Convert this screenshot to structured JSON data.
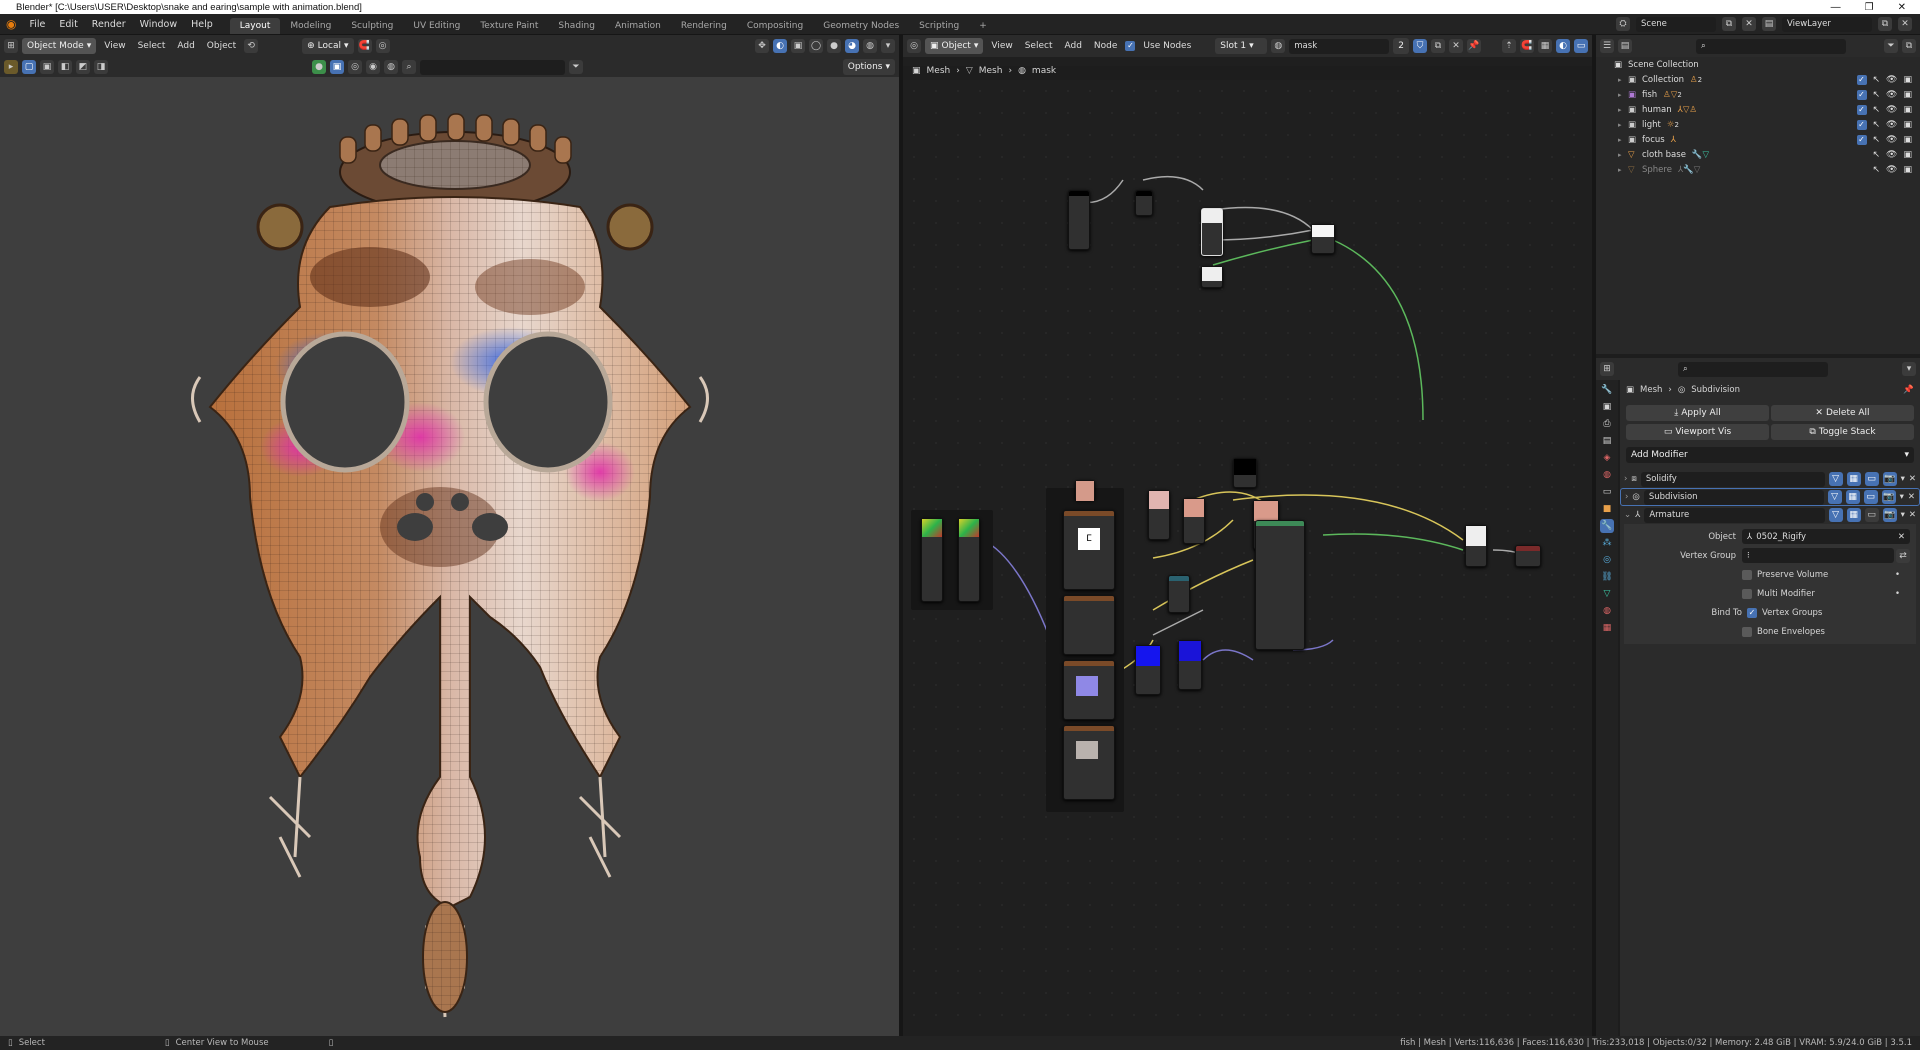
{
  "title": "Blender* [C:\\Users\\USER\\Desktop\\snake and earing\\sample with animation.blend]",
  "menu": [
    "File",
    "Edit",
    "Render",
    "Window",
    "Help"
  ],
  "workspaces": [
    "Layout",
    "Modeling",
    "Sculpting",
    "UV Editing",
    "Texture Paint",
    "Shading",
    "Animation",
    "Rendering",
    "Compositing",
    "Geometry Nodes",
    "Scripting"
  ],
  "active_workspace": "Layout",
  "scene": "Scene",
  "view_layer": "ViewLayer",
  "viewport": {
    "mode": "Object Mode",
    "menus": [
      "View",
      "Select",
      "Add",
      "Object"
    ],
    "orientation": "Local",
    "options": "Options"
  },
  "node_editor": {
    "type": "Object",
    "menus": [
      "View",
      "Select",
      "Add",
      "Node"
    ],
    "use_nodes_label": "Use Nodes",
    "slot": "Slot 1",
    "material": "mask",
    "users": "2",
    "breadcrumb": [
      "Mesh",
      "Mesh",
      "mask"
    ]
  },
  "outliner": {
    "root": "Scene Collection",
    "items": [
      {
        "label": "Collection",
        "suffix": "2"
      },
      {
        "label": "fish",
        "suffix": "2"
      },
      {
        "label": "human",
        "suffix": ""
      },
      {
        "label": "light",
        "suffix": "2"
      },
      {
        "label": "focus",
        "suffix": ""
      },
      {
        "label": "cloth base",
        "suffix": ""
      },
      {
        "label": "Sphere",
        "suffix": ""
      }
    ]
  },
  "properties": {
    "breadcrumb": [
      "Mesh",
      "Subdivision"
    ],
    "apply_all": "Apply All",
    "delete_all": "Delete All",
    "viewport_vis": "Viewport Vis",
    "toggle_stack": "Toggle Stack",
    "add_modifier": "Add Modifier",
    "modifiers": [
      "Solidify",
      "Subdivision",
      "Armature"
    ],
    "armature": {
      "object_label": "Object",
      "object_value": "0502_Rigify",
      "vertex_group_label": "Vertex Group",
      "preserve_volume": "Preserve Volume",
      "multi_modifier": "Multi Modifier",
      "bind_to_label": "Bind To",
      "vertex_groups": "Vertex Groups",
      "bone_envelopes": "Bone Envelopes"
    }
  },
  "status": {
    "left": "Select",
    "middle": "Center View to Mouse",
    "right": "fish | Mesh | Verts:116,636 | Faces:116,630 | Tris:233,018 | Objects:0/32 | Memory: 2.48 GiB | VRAM: 5.9/24.0 GiB | 3.5.1"
  }
}
